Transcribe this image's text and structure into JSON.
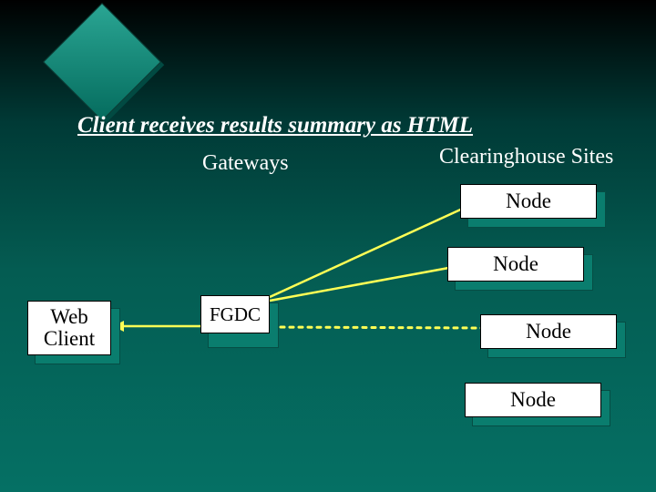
{
  "title": "Client receives results summary as HTML",
  "headings": {
    "gateways": "Gateways",
    "sites": "Clearinghouse Sites"
  },
  "boxes": {
    "web_client": "Web\nClient",
    "fgdc": "FGDC",
    "node1": "Node",
    "node2": "Node",
    "node3": "Node",
    "node4": "Node"
  },
  "connections": [
    {
      "from": "web_client",
      "to": "fgdc",
      "style": "solid"
    },
    {
      "from": "fgdc",
      "to": "node1",
      "style": "solid"
    },
    {
      "from": "fgdc",
      "to": "node2",
      "style": "solid"
    },
    {
      "from": "fgdc",
      "to": "node3",
      "style": "dotted"
    }
  ],
  "colors": {
    "line": "#ffff55",
    "box_face": "#ffffff",
    "box_shadow": "#0a7d6e",
    "text": "#000000"
  }
}
